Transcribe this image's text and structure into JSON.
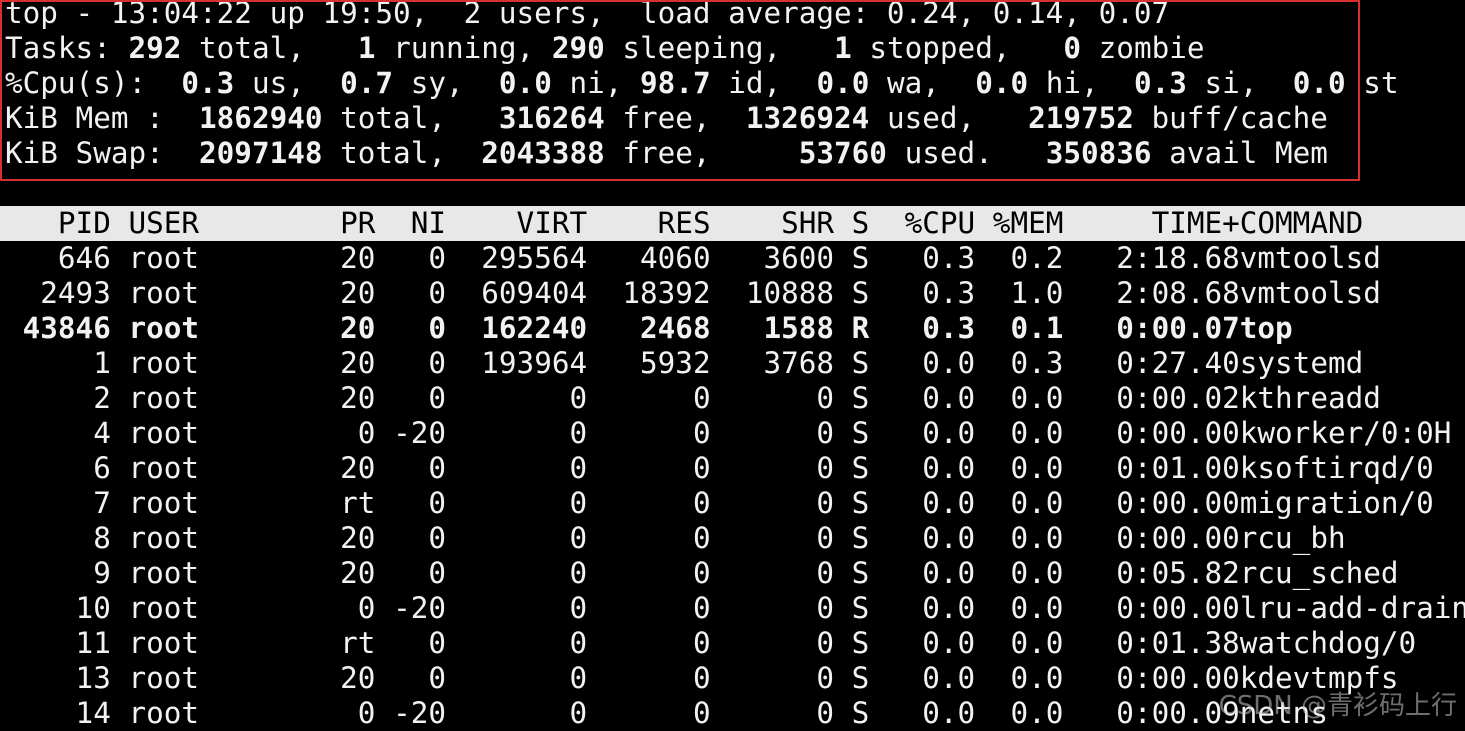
{
  "summary": {
    "line1": "top - 13:04:22 up 19:50,  2 users,  load average: 0.24, 0.14, 0.07",
    "tasks": {
      "label": "Tasks:",
      "total": "292",
      "total_label": "total,",
      "running": "1",
      "running_label": "running,",
      "sleeping": "290",
      "sleeping_label": "sleeping,",
      "stopped": "1",
      "stopped_label": "stopped,",
      "zombie": "0",
      "zombie_label": "zombie"
    },
    "cpu": {
      "label": "%Cpu(s):",
      "us": "0.3",
      "sy": "0.7",
      "ni": "0.0",
      "id": "98.7",
      "wa": "0.0",
      "hi": "0.0",
      "si": "0.3",
      "st": "0.0"
    },
    "mem": {
      "label": "KiB Mem :",
      "total": "1862940",
      "free": "316264",
      "used": "1326924",
      "buff_cache": "219752"
    },
    "swap": {
      "label": "KiB Swap:",
      "total": "2097148",
      "free": "2043388",
      "used": "53760",
      "avail": "350836"
    }
  },
  "columns": [
    "PID",
    "USER",
    "PR",
    "NI",
    "VIRT",
    "RES",
    "SHR",
    "S",
    "%CPU",
    "%MEM",
    "TIME+",
    "COMMAND"
  ],
  "processes": [
    {
      "pid": "646",
      "user": "root",
      "pr": "20",
      "ni": "0",
      "virt": "295564",
      "res": "4060",
      "shr": "3600",
      "s": "S",
      "cpu": "0.3",
      "mem": "0.2",
      "time": "2:18.68",
      "cmd": "vmtoolsd",
      "bold": false
    },
    {
      "pid": "2493",
      "user": "root",
      "pr": "20",
      "ni": "0",
      "virt": "609404",
      "res": "18392",
      "shr": "10888",
      "s": "S",
      "cpu": "0.3",
      "mem": "1.0",
      "time": "2:08.68",
      "cmd": "vmtoolsd",
      "bold": false
    },
    {
      "pid": "43846",
      "user": "root",
      "pr": "20",
      "ni": "0",
      "virt": "162240",
      "res": "2468",
      "shr": "1588",
      "s": "R",
      "cpu": "0.3",
      "mem": "0.1",
      "time": "0:00.07",
      "cmd": "top",
      "bold": true
    },
    {
      "pid": "1",
      "user": "root",
      "pr": "20",
      "ni": "0",
      "virt": "193964",
      "res": "5932",
      "shr": "3768",
      "s": "S",
      "cpu": "0.0",
      "mem": "0.3",
      "time": "0:27.40",
      "cmd": "systemd",
      "bold": false
    },
    {
      "pid": "2",
      "user": "root",
      "pr": "20",
      "ni": "0",
      "virt": "0",
      "res": "0",
      "shr": "0",
      "s": "S",
      "cpu": "0.0",
      "mem": "0.0",
      "time": "0:00.02",
      "cmd": "kthreadd",
      "bold": false
    },
    {
      "pid": "4",
      "user": "root",
      "pr": "0",
      "ni": "-20",
      "virt": "0",
      "res": "0",
      "shr": "0",
      "s": "S",
      "cpu": "0.0",
      "mem": "0.0",
      "time": "0:00.00",
      "cmd": "kworker/0:0H",
      "bold": false
    },
    {
      "pid": "6",
      "user": "root",
      "pr": "20",
      "ni": "0",
      "virt": "0",
      "res": "0",
      "shr": "0",
      "s": "S",
      "cpu": "0.0",
      "mem": "0.0",
      "time": "0:01.00",
      "cmd": "ksoftirqd/0",
      "bold": false
    },
    {
      "pid": "7",
      "user": "root",
      "pr": "rt",
      "ni": "0",
      "virt": "0",
      "res": "0",
      "shr": "0",
      "s": "S",
      "cpu": "0.0",
      "mem": "0.0",
      "time": "0:00.00",
      "cmd": "migration/0",
      "bold": false
    },
    {
      "pid": "8",
      "user": "root",
      "pr": "20",
      "ni": "0",
      "virt": "0",
      "res": "0",
      "shr": "0",
      "s": "S",
      "cpu": "0.0",
      "mem": "0.0",
      "time": "0:00.00",
      "cmd": "rcu_bh",
      "bold": false
    },
    {
      "pid": "9",
      "user": "root",
      "pr": "20",
      "ni": "0",
      "virt": "0",
      "res": "0",
      "shr": "0",
      "s": "S",
      "cpu": "0.0",
      "mem": "0.0",
      "time": "0:05.82",
      "cmd": "rcu_sched",
      "bold": false
    },
    {
      "pid": "10",
      "user": "root",
      "pr": "0",
      "ni": "-20",
      "virt": "0",
      "res": "0",
      "shr": "0",
      "s": "S",
      "cpu": "0.0",
      "mem": "0.0",
      "time": "0:00.00",
      "cmd": "lru-add-drain",
      "bold": false
    },
    {
      "pid": "11",
      "user": "root",
      "pr": "rt",
      "ni": "0",
      "virt": "0",
      "res": "0",
      "shr": "0",
      "s": "S",
      "cpu": "0.0",
      "mem": "0.0",
      "time": "0:01.38",
      "cmd": "watchdog/0",
      "bold": false
    },
    {
      "pid": "13",
      "user": "root",
      "pr": "20",
      "ni": "0",
      "virt": "0",
      "res": "0",
      "shr": "0",
      "s": "S",
      "cpu": "0.0",
      "mem": "0.0",
      "time": "0:00.00",
      "cmd": "kdevtmpfs",
      "bold": false
    },
    {
      "pid": "14",
      "user": "root",
      "pr": "0",
      "ni": "-20",
      "virt": "0",
      "res": "0",
      "shr": "0",
      "s": "S",
      "cpu": "0.0",
      "mem": "0.0",
      "time": "0:00.09",
      "cmd": "netns",
      "bold": false
    }
  ],
  "watermark": "CSDN @青衫码上行"
}
